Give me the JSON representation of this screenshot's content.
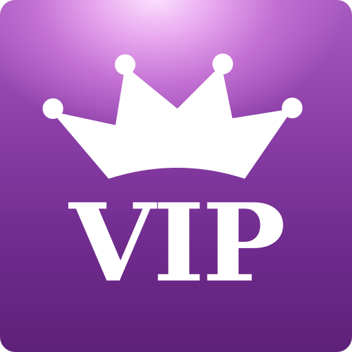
{
  "icon": {
    "name": "crown-icon",
    "label": "VIP",
    "colors": {
      "background_top": "#a85bc2",
      "background_bottom": "#5e2178",
      "highlight": "#fde6ff",
      "foreground": "#ffffff"
    }
  }
}
